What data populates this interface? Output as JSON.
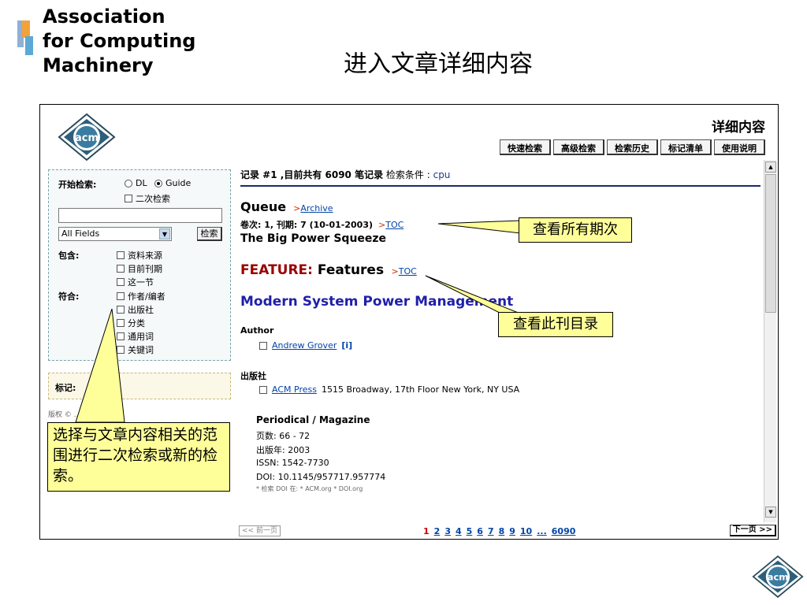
{
  "slide": {
    "org_name_lines": [
      "Association",
      "for Computing",
      "Machinery"
    ],
    "title": "进入文章详细内容"
  },
  "app": {
    "logo_text": "acm",
    "page_heading": "详细内容",
    "nav": [
      "快速检索",
      "高级检索",
      "检索历史",
      "标记清单",
      "使用说明"
    ]
  },
  "search": {
    "start_label": "开始检索:",
    "scope_options": [
      "DL",
      "Guide"
    ],
    "scope_selected": "Guide",
    "secondary_search": "二次检索",
    "query_value": "",
    "field_select": "All Fields",
    "search_button": "检索",
    "include_label": "包含:",
    "include_options": [
      "资料来源",
      "目前刊期",
      "这一节"
    ],
    "match_label": "符合:",
    "match_options": [
      "作者/编者",
      "出版社",
      "分类",
      "通用词",
      "关键词"
    ],
    "mark_label": "标记:",
    "footer": "版权 © ... Group."
  },
  "record": {
    "prefix": "记录 #1 ,目前共有 6090 笔记录",
    "cond_label": "检索条件 : ",
    "cond_value": "cpu",
    "publication": "Queue",
    "archive_link": "Archive",
    "issue_text": "卷次: 1, 刊期: 7  (10-01-2003)",
    "toc_link": "TOC",
    "article_title": "The Big Power Squeeze",
    "feature_label": "FEATURE:",
    "feature_title": "Features",
    "feature_toc": "TOC",
    "heading": "Modern System Power Management",
    "author_label": "Author",
    "author_name": "Andrew Grover",
    "author_info": "[i]",
    "publisher_label": "出版社",
    "publisher_name": "ACM Press",
    "publisher_address": "1515 Broadway, 17th Floor New York, NY USA",
    "type": "Periodical / Magazine",
    "pages": "页数: 66 - 72",
    "year": "出版年: 2003",
    "issn": "ISSN: 1542-7730",
    "doi": "DOI: 10.1145/957717.957774",
    "doi_links": "* 检索 DOI 在:  *  ACM.org  *  DOI.org"
  },
  "pager": {
    "prev": "<< 前一页",
    "pages": [
      "1",
      "2",
      "3",
      "4",
      "5",
      "6",
      "7",
      "8",
      "9",
      "10",
      "...",
      "6090"
    ],
    "current": "1",
    "next": "下一页 >>"
  },
  "callouts": {
    "all_issues": "查看所有期次",
    "toc": "查看此刊目录",
    "refine": "选择与文章内容相关的范围进行二次检索或新的检索。"
  },
  "colors": {
    "callout_bg": "#ffff99",
    "link": "#0044aa",
    "feature_red": "#990000",
    "heading_blue": "#1f1faa"
  }
}
